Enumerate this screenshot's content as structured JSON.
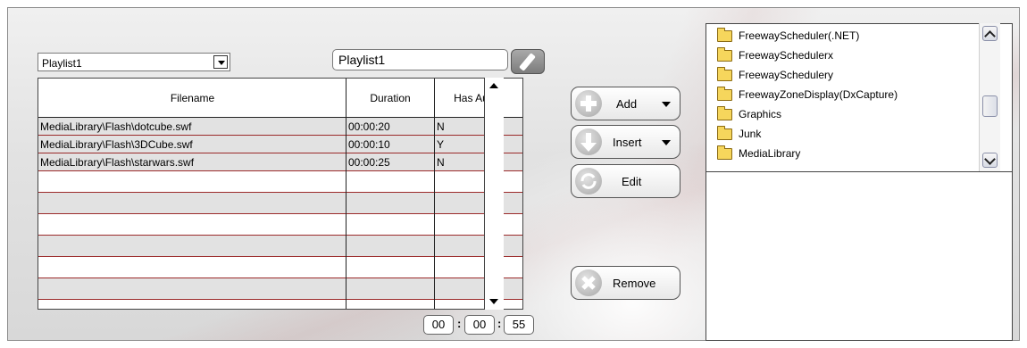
{
  "playlist": {
    "selected": "Playlist1",
    "name_value": "Playlist1"
  },
  "table": {
    "columns": [
      "Filename",
      "Duration",
      "Has Audio"
    ],
    "rows": [
      {
        "filename": "MediaLibrary\\Flash\\dotcube.swf",
        "duration": "00:00:20",
        "audio": "N"
      },
      {
        "filename": "MediaLibrary\\Flash\\3DCube.swf",
        "duration": "00:00:10",
        "audio": "Y"
      },
      {
        "filename": "MediaLibrary\\Flash\\starwars.swf",
        "duration": "00:00:25",
        "audio": "N"
      }
    ]
  },
  "total_time": {
    "hh": "00",
    "mm": "00",
    "ss": "55",
    "sep": ":"
  },
  "actions": {
    "add": "Add",
    "insert": "Insert",
    "edit": "Edit",
    "remove": "Remove"
  },
  "folders": [
    "FreewayScheduler(.NET)",
    "FreewaySchedulerx",
    "FreewaySchedulery",
    "FreewayZoneDisplay(DxCapture)",
    "Graphics",
    "Junk",
    "MediaLibrary"
  ],
  "icons": {
    "dropdown": "chevron-down-icon",
    "edit_name": "pencil-icon",
    "add": "plus-icon",
    "insert": "arrow-down-icon",
    "edit": "refresh-icon",
    "remove": "x-icon",
    "folder": "folder-icon"
  },
  "colors": {
    "row_divider": "#9b2a2a",
    "row_alt": "#e2e2e2",
    "folder": "#f6d65c"
  }
}
